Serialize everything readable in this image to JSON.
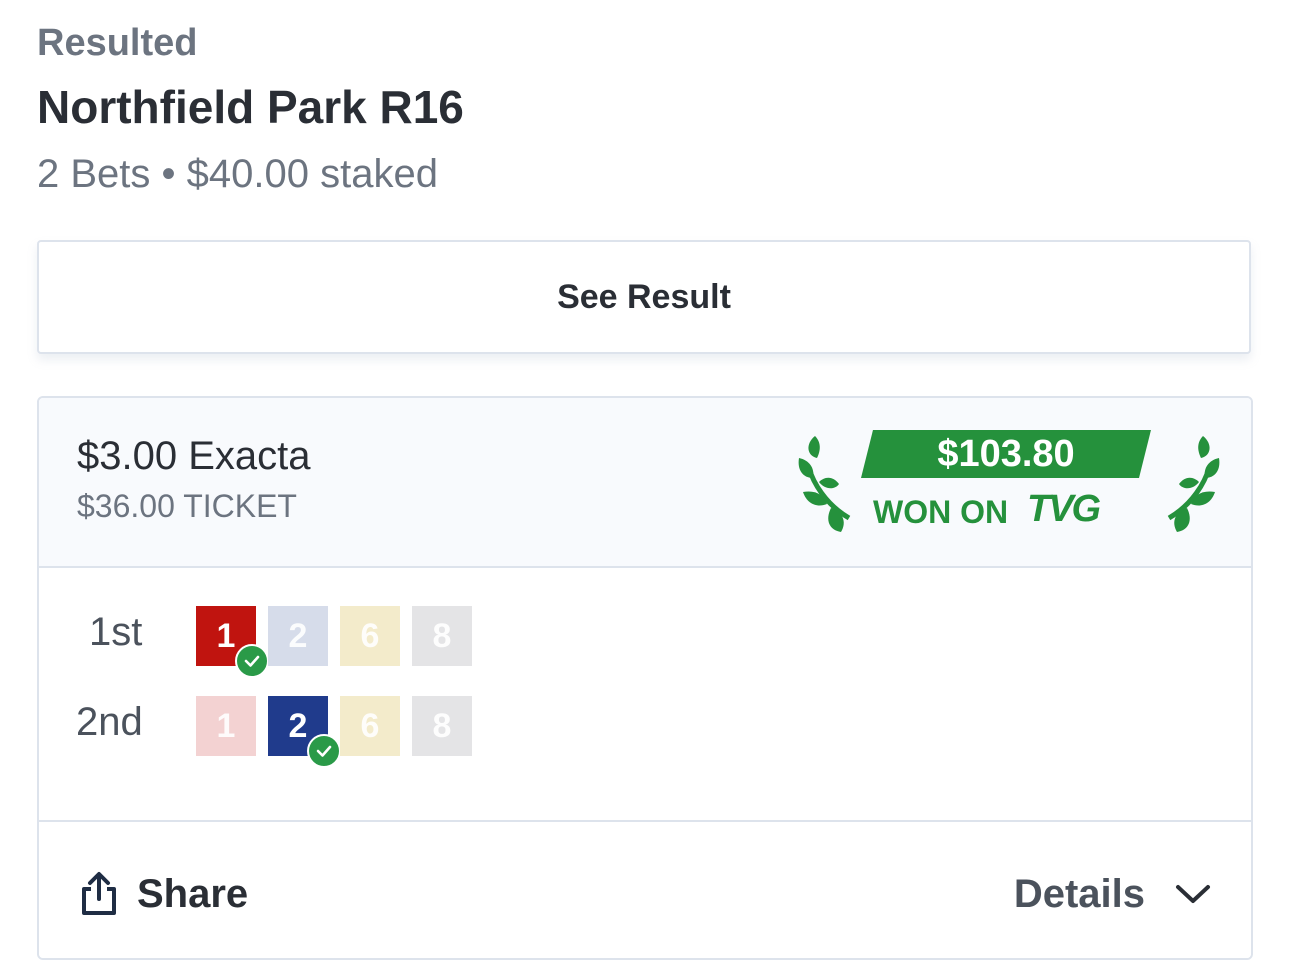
{
  "race": {
    "status": "Resulted",
    "title": "Northfield Park R16",
    "summary": "2 Bets • $40.00 staked"
  },
  "see_result": {
    "label": "See Result"
  },
  "bet": {
    "type": "$3.00 Exacta",
    "ticket": "$36.00 TICKET",
    "win": {
      "amount": "$103.80",
      "won_on": "WON ON",
      "brand": "TVG",
      "color": "#25913c"
    },
    "legs": [
      {
        "place": "1st",
        "runners": [
          {
            "number": "1",
            "winner": true,
            "color": "#c0140f"
          },
          {
            "number": "2",
            "winner": false,
            "color": "#d6dcea"
          },
          {
            "number": "6",
            "winner": false,
            "color": "#f3ebcb"
          },
          {
            "number": "8",
            "winner": false,
            "color": "#e4e4e6"
          }
        ]
      },
      {
        "place": "2nd",
        "runners": [
          {
            "number": "1",
            "winner": false,
            "color": "#f3d2d2"
          },
          {
            "number": "2",
            "winner": true,
            "color": "#203b8c"
          },
          {
            "number": "6",
            "winner": false,
            "color": "#f3ebcb"
          },
          {
            "number": "8",
            "winner": false,
            "color": "#e4e4e6"
          }
        ]
      }
    ]
  },
  "footer": {
    "share_label": "Share",
    "details_label": "Details",
    "share_icon": "share-icon",
    "details_icon": "chevron-down-icon"
  }
}
